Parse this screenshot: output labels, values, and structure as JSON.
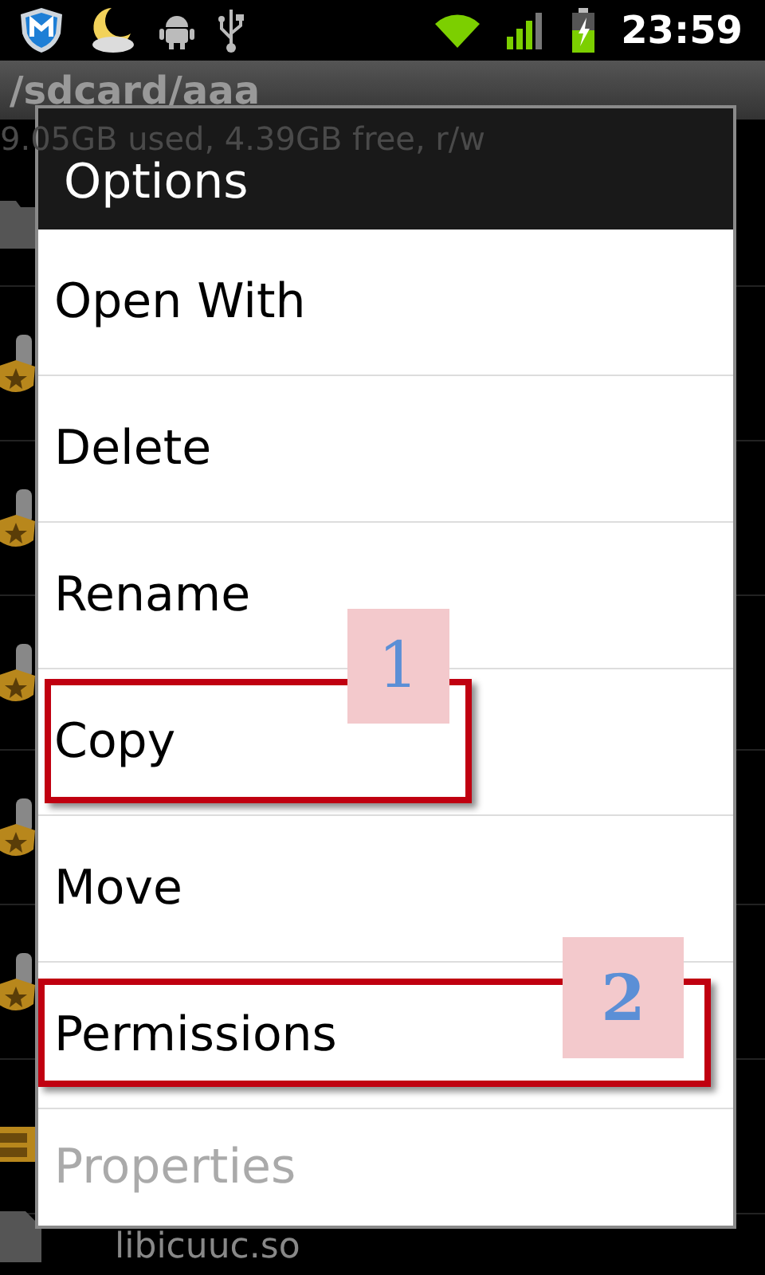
{
  "status_bar": {
    "time": "23:59"
  },
  "path": "/sdcard/aaa",
  "storage": "9.05GB used, 4.39GB free, r/w",
  "files": [
    {
      "kind": "folder"
    },
    {
      "kind": "badge"
    },
    {
      "kind": "badge"
    },
    {
      "kind": "badge"
    },
    {
      "kind": "badge"
    },
    {
      "kind": "badge"
    },
    {
      "kind": "archive"
    },
    {
      "kind": "file",
      "name": "libicuuc.so"
    }
  ],
  "dialog": {
    "title": "Options",
    "items": [
      {
        "label": "Open With",
        "disabled": false
      },
      {
        "label": "Delete",
        "disabled": false
      },
      {
        "label": "Rename",
        "disabled": false
      },
      {
        "label": "Copy",
        "disabled": false,
        "callout": "1"
      },
      {
        "label": "Move",
        "disabled": false
      },
      {
        "label": "Permissions",
        "disabled": false,
        "callout": "2"
      },
      {
        "label": "Properties",
        "disabled": true
      }
    ]
  }
}
